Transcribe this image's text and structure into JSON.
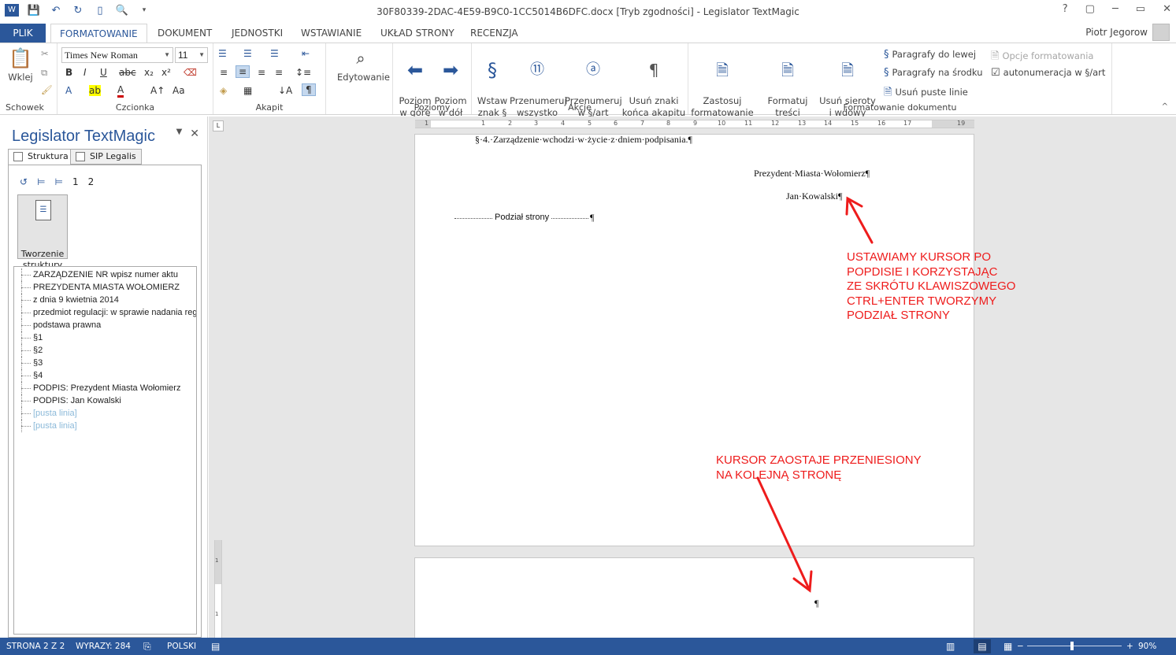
{
  "window": {
    "title": "30F80339-2DAC-4E59-B9C0-1CC5014B6DFC.docx [Tryb zgodności] - Legislator TextMagic",
    "controls": [
      "?",
      "▢",
      "─",
      "▭",
      "✕"
    ]
  },
  "tabs": {
    "file": "PLIK",
    "items": [
      "FORMATOWANIE",
      "DOKUMENT",
      "JEDNOSTKI",
      "WSTAWIANIE",
      "UKŁAD STRONY",
      "RECENZJA"
    ],
    "user": "Piotr Jegorow"
  },
  "ribbon": {
    "clipboard": {
      "label": "Schowek",
      "paste": "Wklej"
    },
    "font": {
      "label": "Czcionka",
      "name": "Times New Roman",
      "size": "11"
    },
    "paragraph": {
      "label": "Akapit"
    },
    "editing": {
      "label": "Edytowanie"
    },
    "levels": {
      "label": "Poziomy",
      "up": "Poziom\nw górę",
      "down": "Poziom\nw dół"
    },
    "actions": {
      "label": "Akcje",
      "insert": "Wstaw\nznak §",
      "renumber_all": "Przenumeruj\nwszystko",
      "renumber_art": "Przenumeruj\nw §/art",
      "remove_marks": "Usuń znaki\nkońca akapitu"
    },
    "docformat": {
      "label": "Formatowanie dokumentu",
      "apply": "Zastosuj\nformatowanie",
      "format_content": "Formatuj treści\nprzepisów",
      "remove_orphans": "Usuń sieroty\ni wdowy",
      "para_left": "Paragrafy do lewej",
      "para_center": "Paragrafy na środku",
      "remove_empty": "Usuń puste linie",
      "options": "Opcje formatowania",
      "autonum": "autonumeracja w §/art"
    }
  },
  "pane": {
    "title": "Legislator TextMagic",
    "tab_structure": "Struktura",
    "tab_sip": "SIP Legalis",
    "level1": "1",
    "level2": "2",
    "struct_button": "Tworzenie\nstruktury\nwłączone",
    "tree": [
      "ZARZĄDZENIE  NR wpisz numer aktu",
      "PREZYDENTA MIASTA WOŁOMIERZ",
      "z dnia  9 kwietnia 2014",
      "przedmiot regulacji: w sprawie nadania regulaminu",
      "podstawa prawna",
      "§1",
      "§2",
      "§3",
      "§4",
      "PODPIS: Prezydent Miasta Wołomierz",
      "PODPIS: Jan Kowalski",
      "[pusta linia]",
      "[pusta linia]"
    ]
  },
  "document": {
    "ruler_ticks": [
      "1",
      "1",
      "2",
      "3",
      "4",
      "5",
      "6",
      "7",
      "8",
      "9",
      "10",
      "11",
      "12",
      "13",
      "14",
      "15",
      "16",
      "17",
      "19"
    ],
    "vruler_ticks": [
      "1",
      "1"
    ],
    "line_par4": "§·4.·Zarządzenie·wchodzi·w·życie·z·dniem·podpisania.¶",
    "line_president": "Prezydent·Miasta·Wołomierz¶",
    "line_name": "Jan·Kowalski¶",
    "page_break_label": "Podział strony",
    "pilcrow": "¶",
    "annotation1": "USTAWIAMY KURSOR PO\nPOPDISIE I KORZYSTAJĄC\nZE SKRÓTU KLAWISZOWEGO\nCTRL+ENTER TWORZYMY\nPODZIAŁ STRONY",
    "annotation2": "KURSOR ZAOSTAJE PRZENIESIONY\nNA KOLEJNĄ STRONĘ",
    "annotation_color": "#ee1c1c"
  },
  "status": {
    "page": "STRONA 2 Z 2",
    "words": "WYRAZY: 284",
    "language": "POLSKI",
    "zoom": "90%"
  },
  "colors": {
    "accent": "#2b579a"
  }
}
